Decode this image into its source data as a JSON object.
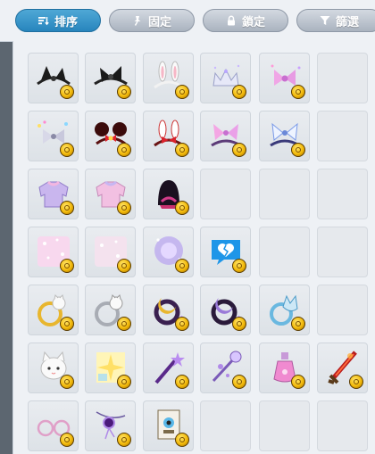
{
  "toolbar": {
    "sort_label": "排序",
    "pin_label": "固定",
    "lock_label": "鎖定",
    "filter_label": "篩選"
  },
  "grid": {
    "rows": [
      [
        {
          "icon": "black-bat-ears-headband-icon",
          "coin": true
        },
        {
          "icon": "black-bow-headband-icon",
          "coin": true
        },
        {
          "icon": "white-bunny-ears-headband-icon",
          "coin": true
        },
        {
          "icon": "silver-crown-icon",
          "coin": true
        },
        {
          "icon": "pink-sparkle-bow-icon",
          "coin": true
        },
        {
          "icon": "",
          "coin": false
        }
      ],
      [
        {
          "icon": "rainbow-sparkle-bow-icon",
          "coin": true
        },
        {
          "icon": "mouse-ears-headband-icon",
          "coin": true
        },
        {
          "icon": "red-bunny-ears-headband-icon",
          "coin": true
        },
        {
          "icon": "pink-ribbon-headband-icon",
          "coin": true
        },
        {
          "icon": "blue-ribbon-headband-icon",
          "coin": true
        },
        {
          "icon": "",
          "coin": false
        }
      ],
      [
        {
          "icon": "lavender-sweater-icon",
          "coin": true
        },
        {
          "icon": "pink-sweater-icon",
          "coin": true
        },
        {
          "icon": "black-magenta-hood-icon",
          "coin": true
        },
        {
          "icon": "",
          "coin": false
        },
        {
          "icon": "",
          "coin": false
        },
        {
          "icon": "",
          "coin": false
        }
      ],
      [
        {
          "icon": "pink-sparkle-effect-icon",
          "coin": true
        },
        {
          "icon": "pink-sparkle-effect-faded-icon",
          "coin": true
        },
        {
          "icon": "purple-glow-effect-icon",
          "coin": true
        },
        {
          "icon": "broken-heart-bubble-icon",
          "coin": true
        },
        {
          "icon": "",
          "coin": false
        },
        {
          "icon": "",
          "coin": false
        }
      ],
      [
        {
          "icon": "gold-moon-cat-ring-icon",
          "coin": true
        },
        {
          "icon": "silver-moon-cat-ring-icon",
          "coin": true
        },
        {
          "icon": "gold-crescent-ring-icon",
          "coin": true
        },
        {
          "icon": "purple-crescent-ring-icon",
          "coin": true
        },
        {
          "icon": "blue-cat-ring-icon",
          "coin": true
        },
        {
          "icon": "",
          "coin": false
        }
      ],
      [
        {
          "icon": "white-cat-face-icon",
          "coin": true
        },
        {
          "icon": "yellow-glow-card-icon",
          "coin": true
        },
        {
          "icon": "purple-star-wand-icon",
          "coin": true
        },
        {
          "icon": "purple-orb-staff-icon",
          "coin": true
        },
        {
          "icon": "pink-potion-bottle-icon",
          "coin": true
        },
        {
          "icon": "red-flame-sword-icon",
          "coin": true
        }
      ],
      [
        {
          "icon": "pink-glasses-icon",
          "coin": true
        },
        {
          "icon": "purple-gem-pendant-icon",
          "coin": true
        },
        {
          "icon": "eye-tag-charm-icon",
          "coin": true
        },
        {
          "icon": "",
          "coin": false
        },
        {
          "icon": "",
          "coin": false
        },
        {
          "icon": "",
          "coin": false
        }
      ]
    ]
  }
}
